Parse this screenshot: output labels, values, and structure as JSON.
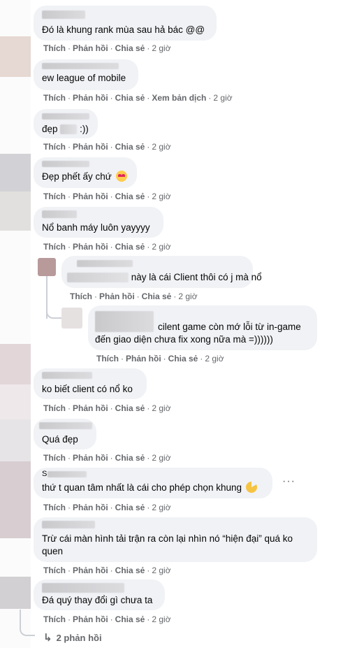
{
  "comments": [
    {
      "text": "Đó là khung rank mùa sau hả bác @@",
      "like": "Thích",
      "reply": "Phản hồi",
      "share": "Chia sẻ",
      "time": "2 giờ"
    },
    {
      "text": "ew league of mobile",
      "like": "Thích",
      "reply": "Phản hồi",
      "share": "Chia sẻ",
      "translate": "Xem bản dịch",
      "time": "2 giờ"
    },
    {
      "text_prefix": "đẹp",
      "text_suffix": ":))",
      "like": "Thích",
      "reply": "Phản hồi",
      "share": "Chia sẻ",
      "time": "2 giờ"
    },
    {
      "text": "Đẹp phết ấy chứ",
      "emoji": "heart-eyes-emoji",
      "like": "Thích",
      "reply": "Phản hồi",
      "share": "Chia sẻ",
      "time": "2 giờ"
    },
    {
      "text": "Nổ banh máy luôn yayyyy",
      "like": "Thích",
      "reply": "Phản hồi",
      "share": "Chia sẻ",
      "time": "2 giờ"
    }
  ],
  "replies_thread": [
    {
      "text": "này là cái Client thôi có j mà nổ",
      "like": "Thích",
      "reply": "Phản hồi",
      "share": "Chia sẻ",
      "time": "2 giờ"
    },
    {
      "line1": "cilent game còn mớ lỗi từ in-game",
      "line2": "đến giao diện chưa fix xong nữa mà =))))))",
      "like": "Thích",
      "reply": "Phản hồi",
      "share": "Chia sẻ",
      "time": "2 giờ"
    }
  ],
  "comments2": [
    {
      "text": "ko biết client có nổ ko",
      "like": "Thích",
      "reply": "Phản hồi",
      "share": "Chia sẻ",
      "time": "2 giờ"
    },
    {
      "text": "Quá đẹp",
      "like": "Thích",
      "reply": "Phản hồi",
      "share": "Chia sẻ",
      "time": "2 giờ"
    },
    {
      "name_initial": "S",
      "text": "thứ t quan tâm nhất là cái cho phép chọn khung",
      "emoji": "pacman-emoji",
      "like": "Thích",
      "reply": "Phản hồi",
      "share": "Chia sẻ",
      "time": "2 giờ"
    },
    {
      "line1": "Trừ cái màn hình tải trận ra còn lại nhìn nó “hiện đại” quá ko",
      "line2": "quen",
      "like": "Thích",
      "reply": "Phản hồi",
      "share": "Chia sẻ",
      "time": "2 giờ"
    },
    {
      "text": "Đá quý thay đổi gì chưa ta",
      "like": "Thích",
      "reply": "Phản hồi",
      "share": "Chia sẻ",
      "time": "2 giờ"
    }
  ],
  "view_replies": "2 phản hồi",
  "icons": {
    "reply_arrow": "reply-arrow-icon",
    "more": "more-options-icon"
  }
}
